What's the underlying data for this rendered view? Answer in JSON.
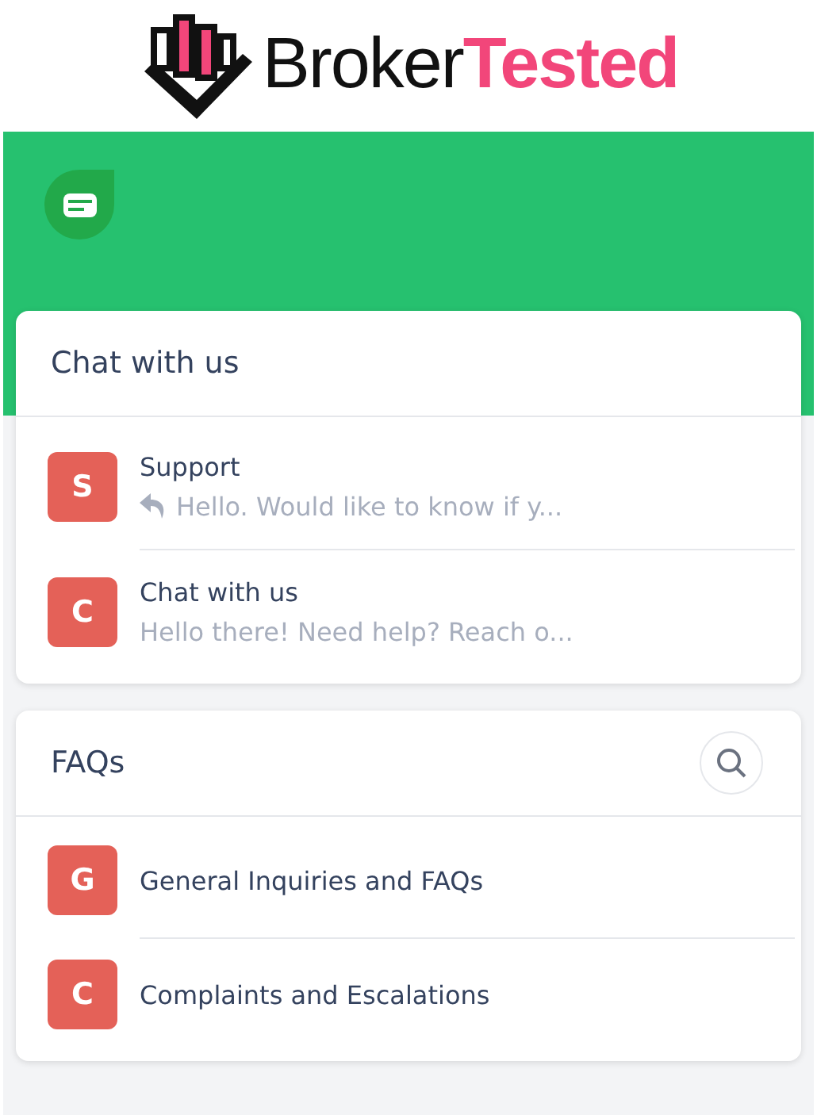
{
  "logo": {
    "name_dark": "Broker",
    "name_accent": "Tested"
  },
  "chat_card": {
    "title": "Chat with us",
    "conversations": [
      {
        "avatar": "S",
        "name": "Support",
        "preview": "Hello. Would like to know if y...",
        "replied": true
      },
      {
        "avatar": "C",
        "name": "Chat with us",
        "preview": "Hello there! Need help? Reach o...",
        "replied": false
      }
    ]
  },
  "faq_card": {
    "title": "FAQs",
    "topics": [
      {
        "avatar": "G",
        "label": "General Inquiries and FAQs"
      },
      {
        "avatar": "C",
        "label": "Complaints and Escalations"
      }
    ]
  }
}
